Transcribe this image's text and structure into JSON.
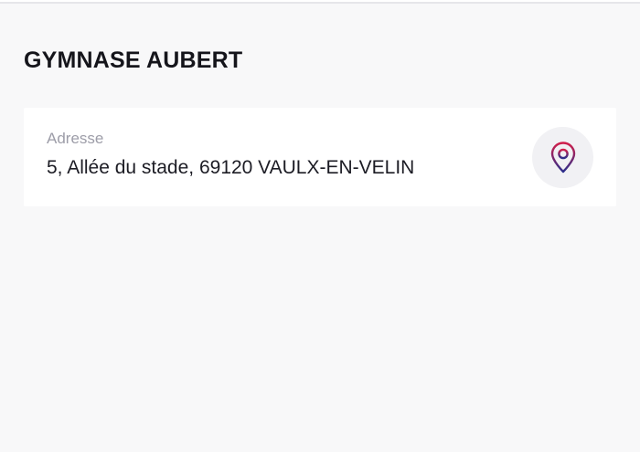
{
  "venue": {
    "title": "GYMNASE AUBERT"
  },
  "address": {
    "label": "Adresse",
    "value": "5, Allée du stade, 69120 VAULX-EN-VELIN",
    "icon": "map-pin-icon"
  },
  "colors": {
    "background": "#f8f8f9",
    "card": "#ffffff",
    "icon_gradient_start": "#d11f4b",
    "icon_gradient_end": "#2c2f8c"
  }
}
